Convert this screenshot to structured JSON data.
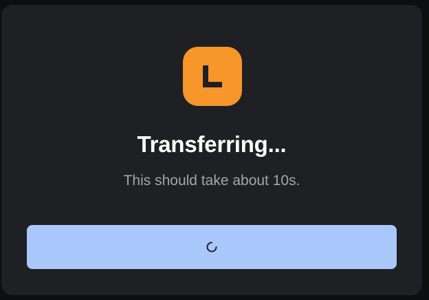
{
  "dialog": {
    "logo_letter": "L",
    "title": "Transferring...",
    "subtitle": "This should take about 10s.",
    "progress_icon": "spinner-icon"
  },
  "colors": {
    "modal_background": "#1f2023",
    "logo_background": "#f7962a",
    "logo_glyph": "#1f2023",
    "title": "#ffffff",
    "subtitle": "#a4a6ab",
    "button_background": "#a8c7fa",
    "spinner": "#1f2023"
  }
}
